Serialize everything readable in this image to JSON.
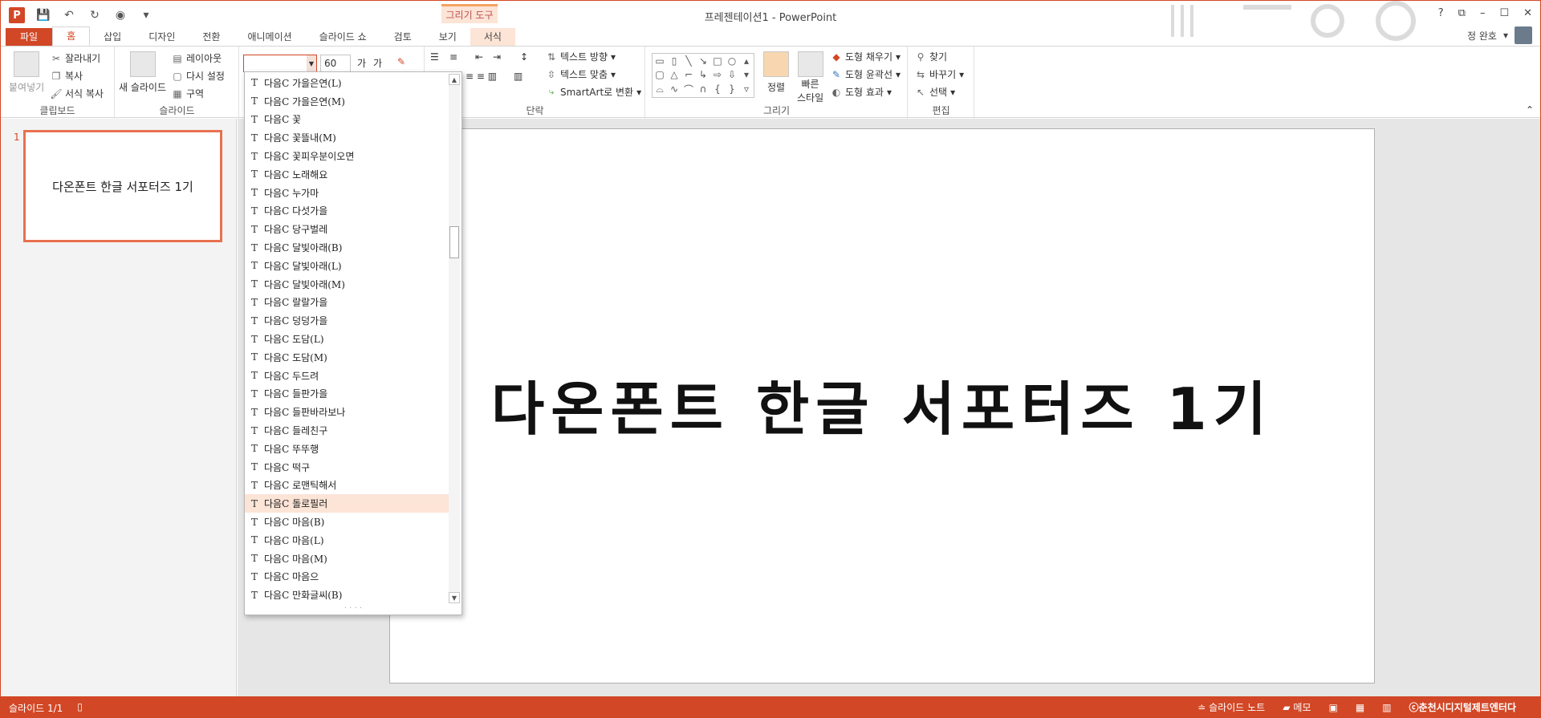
{
  "app": {
    "title": "프레젠테이션1 - PowerPoint",
    "logo_letter": "P",
    "context_tab_group": "그리기 도구",
    "window_controls": [
      "?",
      "⧉",
      "–",
      "☐",
      "✕"
    ],
    "user_name": "정 완호"
  },
  "tabs": [
    {
      "label": "파일"
    },
    {
      "label": "홈"
    },
    {
      "label": "삽입"
    },
    {
      "label": "디자인"
    },
    {
      "label": "전환"
    },
    {
      "label": "애니메이션"
    },
    {
      "label": "슬라이드 쇼"
    },
    {
      "label": "검토"
    },
    {
      "label": "보기"
    },
    {
      "label": "서식"
    }
  ],
  "ribbon": {
    "clipboard": {
      "label": "클립보드",
      "paste": "붙여넣기",
      "cut": "잘라내기",
      "copy": "복사",
      "format_painter": "서식 복사"
    },
    "slides": {
      "label": "슬라이드",
      "new_slide": "새 슬라이드",
      "layout": "레이아웃",
      "reset": "다시 설정",
      "section": "구역"
    },
    "font": {
      "current_font": "",
      "size": "60",
      "grow": "가",
      "shrink": "가"
    },
    "paragraph": {
      "label": "단락",
      "text_direction": "텍스트 방향",
      "align_text": "텍스트 맞춤",
      "smartart": "SmartArt로 변환"
    },
    "drawing": {
      "label": "그리기",
      "arrange": "정렬",
      "quick_styles_1": "빠른",
      "quick_styles_2": "스타일",
      "fill": "도형 채우기",
      "outline": "도형 윤곽선",
      "effects": "도형 효과"
    },
    "editing": {
      "label": "편집",
      "find": "찾기",
      "replace": "바꾸기",
      "select": "선택"
    }
  },
  "font_list": [
    "다음C 가을은연(L)",
    "다음C 가을은연(M)",
    "다음C 꽃",
    "다음C 꽃뜰내(M)",
    "다음C 꽃피우분이오면",
    "다음C 노래해요",
    "다음C 누가마",
    "다음C 다섯가을",
    "다음C 당구벌레",
    "다음C 달빛아래(B)",
    "다음C 달빛아래(L)",
    "다음C 달빛아래(M)",
    "다음C 랄랄가을",
    "다음C 덩덩가을",
    "다음C 도담(L)",
    "다음C 도담(M)",
    "다음C 두드려",
    "다음C 들판가을",
    "다음C 들판바라보나",
    "다음C 들레친구",
    "다음C 뚜뚜행",
    "다음C 떡구",
    "다음C 로맨틱해서",
    "다음C 돌로필러",
    "다음C 마음(B)",
    "다음C 마음(L)",
    "다음C 마음(M)",
    "다음C 마음으",
    "다음C 만화글씨(B)"
  ],
  "selected_font_index": 23,
  "slide_panel": {
    "number": "1",
    "thumb_text": "다온폰트 한글 서포터즈 1기"
  },
  "slide": {
    "text": "다온폰트 한글 서포터즈 1기"
  },
  "status": {
    "slide_info": "슬라이드 1/1",
    "notes": "슬라이드 노트",
    "comments": "메모",
    "watermark": "ⓒ춘천시디지털제트엔터다"
  }
}
